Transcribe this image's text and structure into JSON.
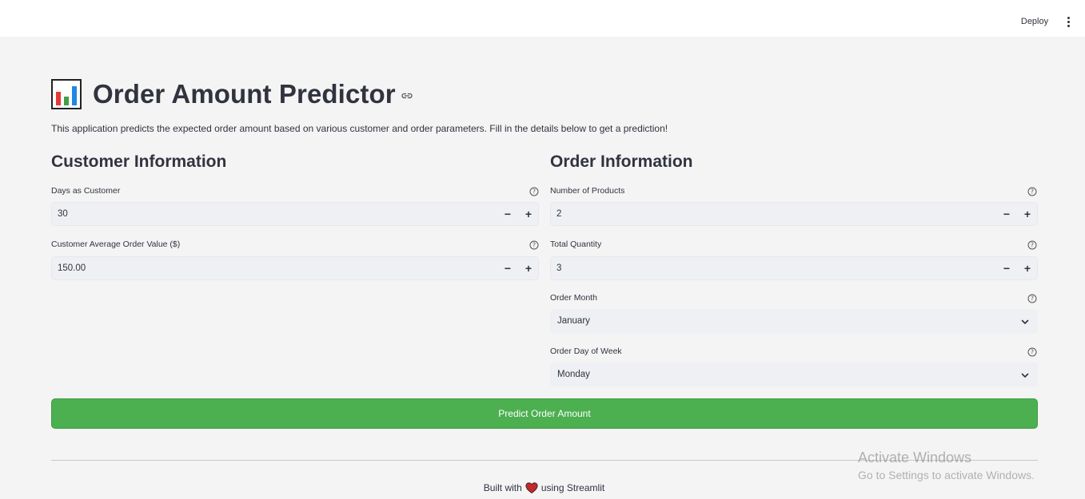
{
  "header": {
    "deploy_label": "Deploy",
    "menu_icon": "kebab-menu-icon"
  },
  "page": {
    "title": "Order Amount Predictor",
    "title_icon": "bar-chart-emoji",
    "description": "This application predicts the expected order amount based on various customer and order parameters. Fill in the details below to get a prediction!"
  },
  "customer": {
    "heading": "Customer Information",
    "days_label": "Days as Customer",
    "days_value": "30",
    "aov_label": "Customer Average Order Value ($)",
    "aov_value": "150.00"
  },
  "order": {
    "heading": "Order Information",
    "num_products_label": "Number of Products",
    "num_products_value": "2",
    "total_qty_label": "Total Quantity",
    "total_qty_value": "3",
    "month_label": "Order Month",
    "month_value": "January",
    "dow_label": "Order Day of Week",
    "dow_value": "Monday"
  },
  "stepper": {
    "minus": "−",
    "plus": "+"
  },
  "actions": {
    "predict_label": "Predict Order Amount"
  },
  "footer": {
    "built_with": "Built with",
    "using": "using Streamlit"
  },
  "watermark": {
    "line1": "Activate Windows",
    "line2": "Go to Settings to activate Windows."
  },
  "colors": {
    "button_green": "#4caf50",
    "background": "#f4f4f4",
    "input_bg": "#eef0f3",
    "text": "#31333f"
  }
}
